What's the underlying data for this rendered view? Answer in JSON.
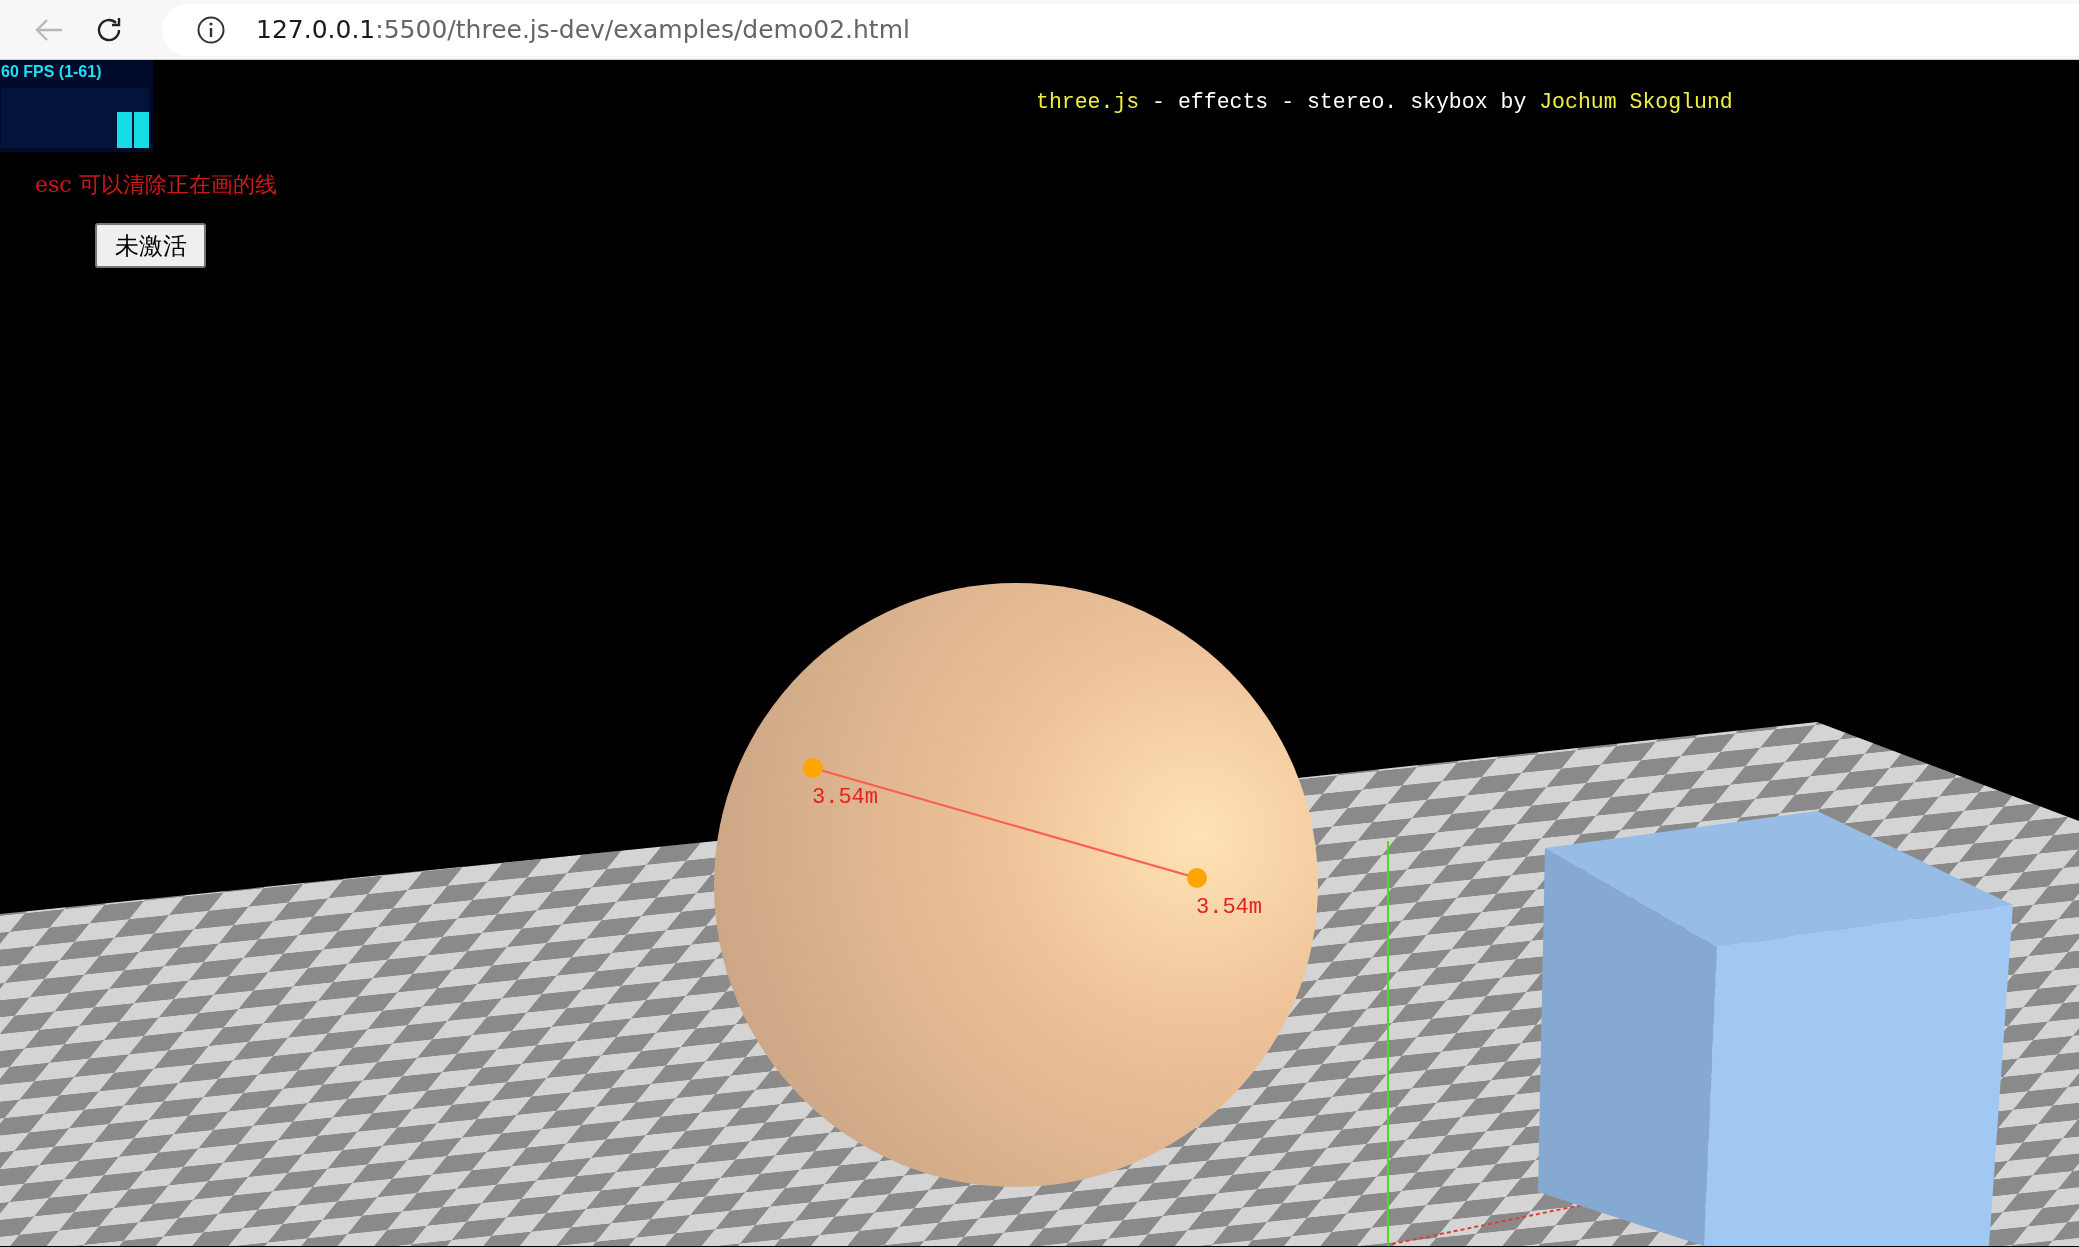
{
  "browser": {
    "url_host": "127.0.0.1",
    "url_path": ":5500/three.js-dev/examples/demo02.html"
  },
  "stats": {
    "label": "60 FPS (1-61)"
  },
  "info": [
    {
      "kind": "link",
      "text": "three.js"
    },
    {
      "kind": "text",
      "text": " - effects - stereo. skybox by "
    },
    {
      "kind": "link",
      "text": "Jochum Skoglund"
    }
  ],
  "hint": "esc 可以清除正在画的线",
  "button": {
    "label": "未激活"
  },
  "measurements": [
    {
      "label": "3.54m"
    },
    {
      "label": "3.54m"
    }
  ]
}
